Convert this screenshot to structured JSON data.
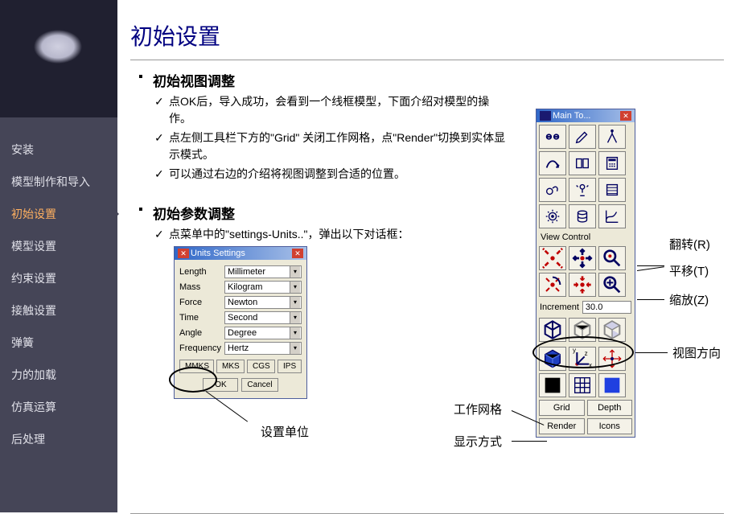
{
  "title": "初始设置",
  "sidebar": {
    "items": [
      {
        "label": "安装"
      },
      {
        "label": "模型制作和导入"
      },
      {
        "label": "初始设置"
      },
      {
        "label": "模型设置"
      },
      {
        "label": "约束设置"
      },
      {
        "label": "接触设置"
      },
      {
        "label": "弹簧"
      },
      {
        "label": "力的加载"
      },
      {
        "label": "仿真运算"
      },
      {
        "label": "后处理"
      }
    ],
    "active_index": 2
  },
  "section1": {
    "title": "初始视图调整",
    "bullets": [
      "点OK后，导入成功，会看到一个线框模型，下面介绍对模型的操作。",
      "点左侧工具栏下方的\"Grid\" 关闭工作网格，点\"Render\"切换到实体显示模式。",
      "可以通过右边的介绍将视图调整到合适的位置。"
    ]
  },
  "section2": {
    "title": "初始参数调整",
    "bullets": [
      "点菜单中的\"settings-Units..\"，弹出以下对话框："
    ]
  },
  "units_dialog": {
    "title": "Units Settings",
    "rows": [
      {
        "label": "Length",
        "value": "Millimeter"
      },
      {
        "label": "Mass",
        "value": "Kilogram"
      },
      {
        "label": "Force",
        "value": "Newton"
      },
      {
        "label": "Time",
        "value": "Second"
      },
      {
        "label": "Angle",
        "value": "Degree"
      },
      {
        "label": "Frequency",
        "value": "Hertz"
      }
    ],
    "systems": [
      "MMKS",
      "MKS",
      "CGS",
      "IPS"
    ],
    "ok": "OK",
    "cancel": "Cancel"
  },
  "units_annotation": "设置单位",
  "toolbox": {
    "title": "Main To...",
    "view_control_label": "View Control",
    "increment_label": "Increment",
    "increment_value": "30.0",
    "grid_btn": "Grid",
    "depth_btn": "Depth",
    "render_btn": "Render",
    "icons_btn": "Icons"
  },
  "callouts": {
    "rotate": "翻转(R)",
    "translate": "平移(T)",
    "zoom": "缩放(Z)",
    "view_dir": "视图方向",
    "work_grid": "工作网格",
    "display_mode": "显示方式"
  }
}
